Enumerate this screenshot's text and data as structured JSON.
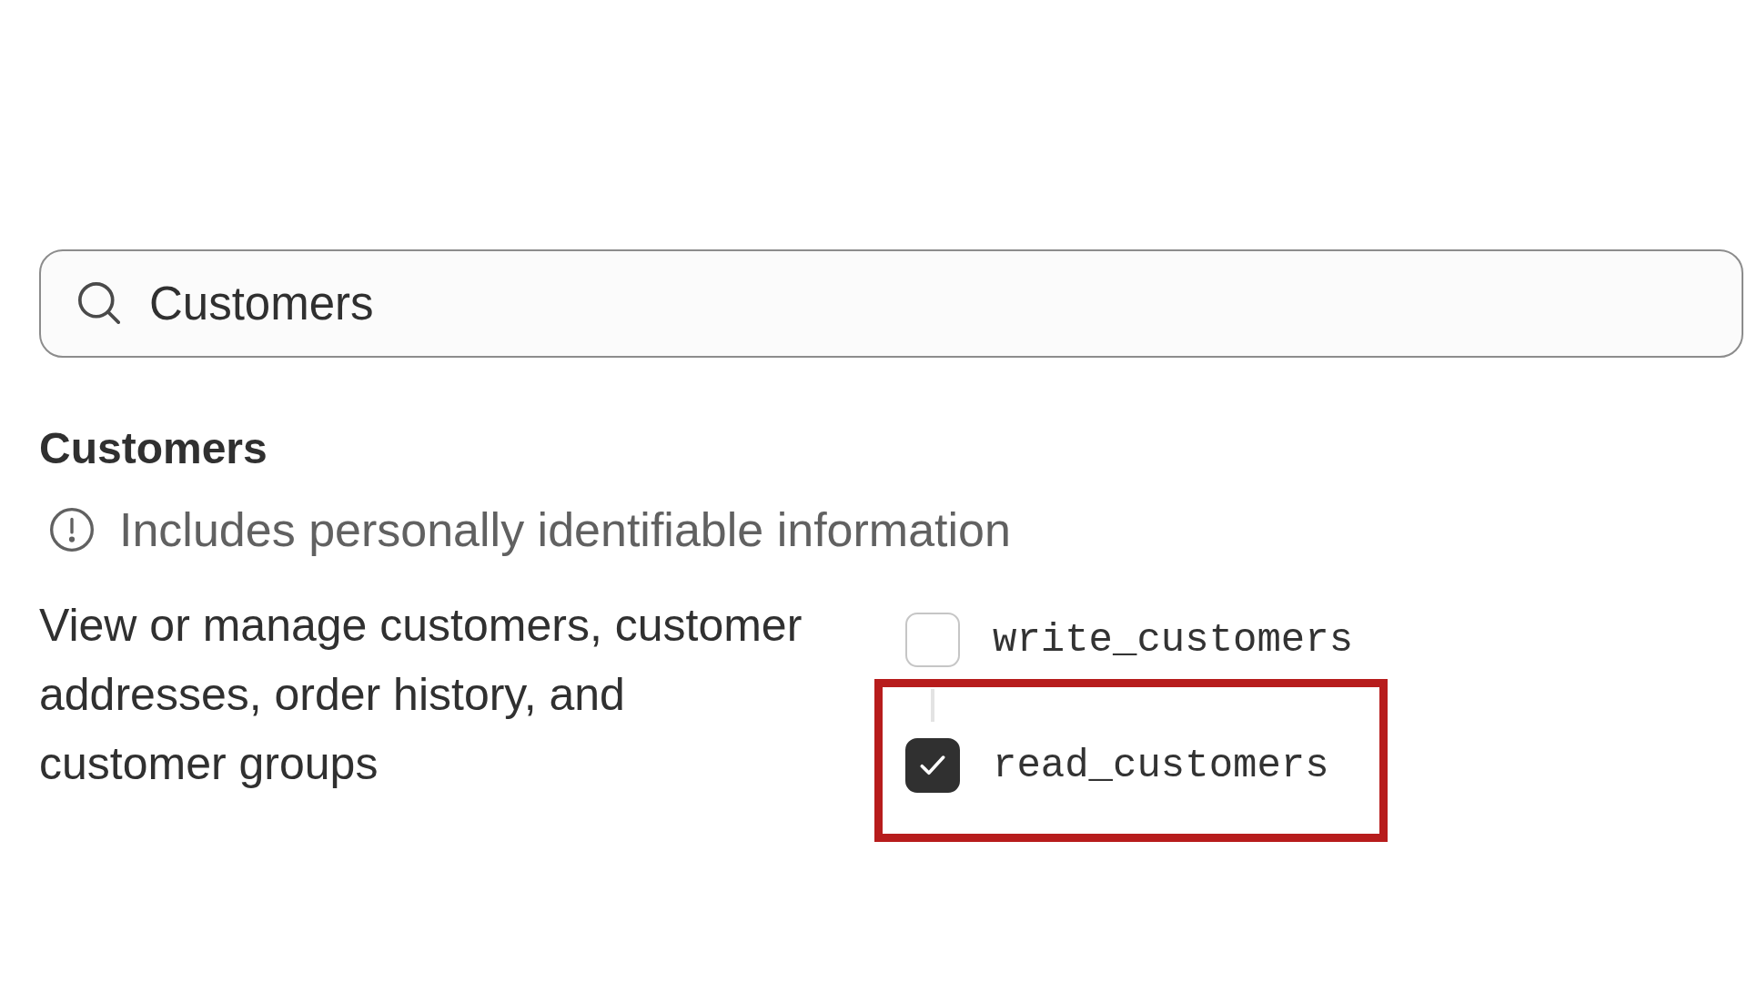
{
  "search": {
    "value": "Customers"
  },
  "section": {
    "title": "Customers",
    "notice": "Includes personally identifiable information",
    "description": "View or manage customers, customer addresses, order history, and customer groups"
  },
  "permissions": [
    {
      "label": "write_customers",
      "checked": false,
      "highlighted": false
    },
    {
      "label": "read_customers",
      "checked": true,
      "highlighted": true
    }
  ]
}
